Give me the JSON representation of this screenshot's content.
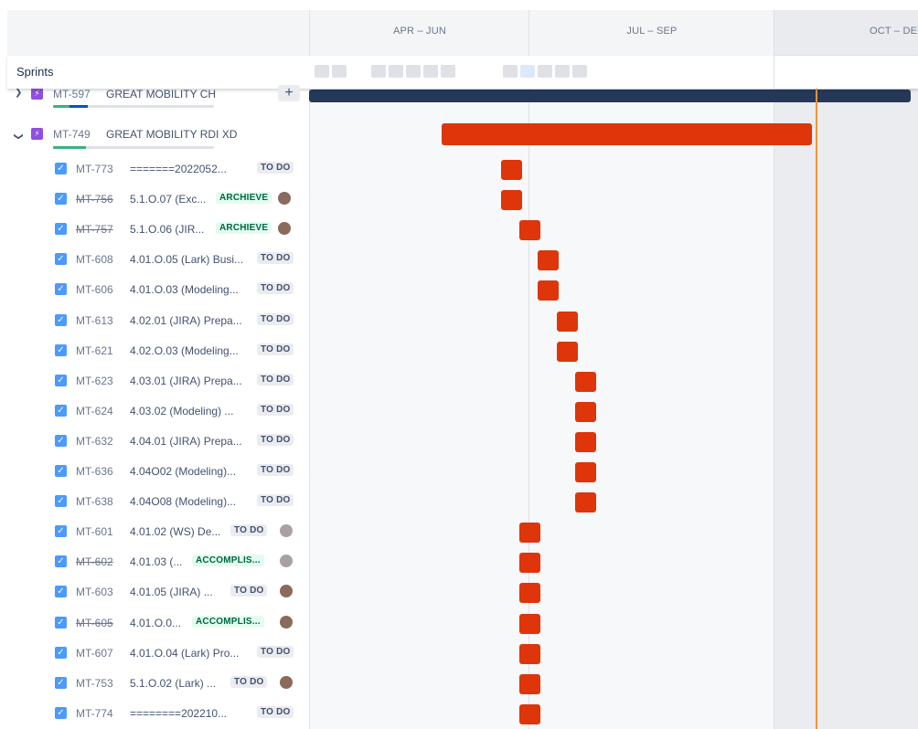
{
  "timeline": {
    "months": [
      "APR – JUN",
      "JUL – SEP",
      "OCT – DEC"
    ],
    "sprints_label": "Sprints"
  },
  "epics": [
    {
      "key": "MT-597",
      "summary": "GREAT MOBILITY CH",
      "progress_done": 0.1,
      "progress_inprogress": 0.12
    },
    {
      "key": "MT-749",
      "summary": "GREAT MOBILITY RDI XD",
      "progress_done": 0.2,
      "progress_inprogress": 0.0
    }
  ],
  "issues": [
    {
      "key": "MT-773",
      "summary": "=======2022052...",
      "status": "TO DO",
      "done": false,
      "avatar": false
    },
    {
      "key": "MT-756",
      "summary": "5.1.O.07 (Exc...",
      "status": "ARCHIEVE",
      "done": true,
      "avatar": true
    },
    {
      "key": "MT-757",
      "summary": "5.1.O.06 (JIR...",
      "status": "ARCHIEVE",
      "done": true,
      "avatar": true
    },
    {
      "key": "MT-608",
      "summary": "4.01.O.05 (Lark) Busi...",
      "status": "TO DO",
      "done": false,
      "avatar": false
    },
    {
      "key": "MT-606",
      "summary": "4.01.O.03 (Modeling...",
      "status": "TO DO",
      "done": false,
      "avatar": false
    },
    {
      "key": "MT-613",
      "summary": "4.02.01 (JIRA) Prepa...",
      "status": "TO DO",
      "done": false,
      "avatar": false
    },
    {
      "key": "MT-621",
      "summary": "4.02.O.03 (Modeling...",
      "status": "TO DO",
      "done": false,
      "avatar": false
    },
    {
      "key": "MT-623",
      "summary": "4.03.01 (JIRA) Prepa...",
      "status": "TO DO",
      "done": false,
      "avatar": false
    },
    {
      "key": "MT-624",
      "summary": "4.03.02 (Modeling) ...",
      "status": "TO DO",
      "done": false,
      "avatar": false
    },
    {
      "key": "MT-632",
      "summary": "4.04.01 (JIRA) Prepa...",
      "status": "TO DO",
      "done": false,
      "avatar": false
    },
    {
      "key": "MT-636",
      "summary": "4.04O02 (Modeling)...",
      "status": "TO DO",
      "done": false,
      "avatar": false
    },
    {
      "key": "MT-638",
      "summary": "4.04O08 (Modeling)...",
      "status": "TO DO",
      "done": false,
      "avatar": false
    },
    {
      "key": "MT-601",
      "summary": "4.01.02 (WS) De...",
      "status": "TO DO",
      "done": false,
      "avatar": true
    },
    {
      "key": "MT-602",
      "summary": "4.01.03 (...",
      "status": "ACCOMPLIS...",
      "done": true,
      "avatar": true
    },
    {
      "key": "MT-603",
      "summary": "4.01.05 (JIRA) ...",
      "status": "TO DO",
      "done": false,
      "avatar": true
    },
    {
      "key": "MT-605",
      "summary": "4.01.O.0...",
      "status": "ACCOMPLIS...",
      "done": true,
      "avatar": true
    },
    {
      "key": "MT-607",
      "summary": "4.01.O.04 (Lark) Pro...",
      "status": "TO DO",
      "done": false,
      "avatar": false
    },
    {
      "key": "MT-753",
      "summary": "5.1.O.02 (Lark) ...",
      "status": "TO DO",
      "done": false,
      "avatar": true
    },
    {
      "key": "MT-774",
      "summary": "========202210...",
      "status": "TO DO",
      "done": false,
      "avatar": false
    }
  ],
  "colors": {
    "epic": "#904ee2",
    "checkbox": "#4c9aff",
    "bar_task": "#de350b",
    "bar_epic_dark": "#253858",
    "today_line": "#f79232",
    "badge_green": "#006644"
  }
}
